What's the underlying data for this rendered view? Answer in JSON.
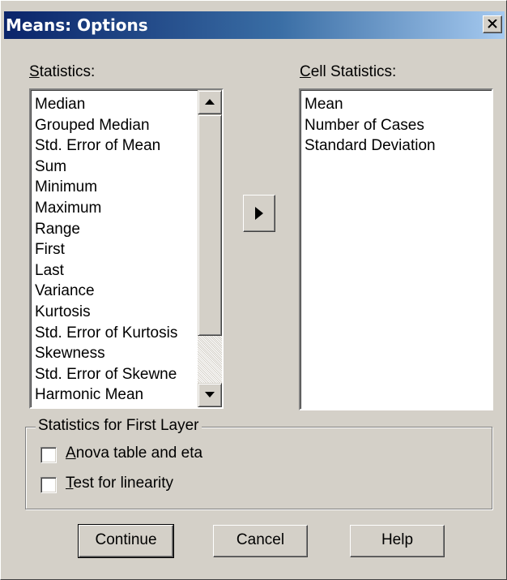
{
  "window": {
    "title": "Means: Options",
    "close_icon": "close-icon"
  },
  "statistics": {
    "label_mnemonic": "S",
    "label_rest": "tatistics:",
    "items": [
      "Median",
      "Grouped Median",
      "Std. Error of Mean",
      "Sum",
      "Minimum",
      "Maximum",
      "Range",
      "First",
      "Last",
      "Variance",
      "Kurtosis",
      "Std. Error of Kurtosis",
      "Skewness",
      "Std. Error of Skewne",
      "Harmonic Mean"
    ],
    "scroll_position": 0.0
  },
  "cell_statistics": {
    "label_mnemonic": "C",
    "label_rest": "ell Statistics:",
    "items": [
      "Mean",
      "Number of Cases",
      "Standard Deviation"
    ]
  },
  "move_button": {
    "icon": "right-arrow-icon"
  },
  "first_layer": {
    "title": "Statistics for First Layer",
    "anova": {
      "mnemonic": "A",
      "rest": "nova table and eta",
      "checked": false
    },
    "linearity": {
      "mnemonic": "T",
      "rest": "est for linearity",
      "checked": false
    }
  },
  "buttons": {
    "continue": "Continue",
    "cancel": "Cancel",
    "help": "Help"
  },
  "colors": {
    "titlebar_start": "#0a246a",
    "titlebar_end": "#a6caf0",
    "face": "#d4d0c8"
  }
}
